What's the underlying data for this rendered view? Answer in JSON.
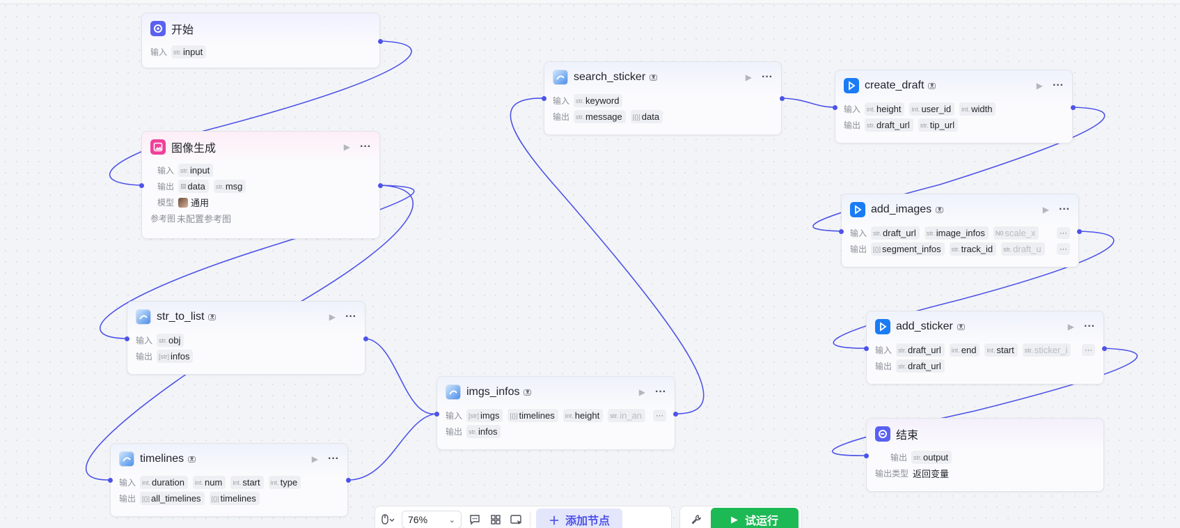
{
  "nodes": {
    "start": {
      "title": "开始",
      "input_label": "输入",
      "inputs": [
        {
          "type": "str.",
          "name": "input"
        }
      ]
    },
    "image_gen": {
      "title": "图像生成",
      "input_label": "输入",
      "inputs": [
        {
          "type": "str.",
          "name": "input"
        }
      ],
      "output_label": "输出",
      "outputs": [
        {
          "type": "img",
          "name": "data"
        },
        {
          "type": "str.",
          "name": "msg"
        }
      ],
      "model_label": "模型",
      "model_value": "通用",
      "ref_label": "参考图",
      "ref_value": "未配置参考图"
    },
    "search_sticker": {
      "title": "search_sticker",
      "input_label": "输入",
      "inputs": [
        {
          "type": "str.",
          "name": "keyword"
        }
      ],
      "output_label": "输出",
      "outputs": [
        {
          "type": "str.",
          "name": "message"
        },
        {
          "type": "[{}]",
          "name": "data"
        }
      ]
    },
    "create_draft": {
      "title": "create_draft",
      "input_label": "输入",
      "inputs": [
        {
          "type": "int.",
          "name": "height"
        },
        {
          "type": "int.",
          "name": "user_id"
        },
        {
          "type": "int.",
          "name": "width"
        }
      ],
      "output_label": "输出",
      "outputs": [
        {
          "type": "str.",
          "name": "draft_url"
        },
        {
          "type": "str.",
          "name": "tip_url"
        }
      ]
    },
    "add_images": {
      "title": "add_images",
      "input_label": "输入",
      "inputs": [
        {
          "type": "str.",
          "name": "draft_url"
        },
        {
          "type": "str.",
          "name": "image_infos"
        },
        {
          "type": "N0",
          "name": "scale_x"
        }
      ],
      "output_label": "输出",
      "outputs": [
        {
          "type": "[{}]",
          "name": "segment_infos"
        },
        {
          "type": "str.",
          "name": "track_id"
        },
        {
          "type": "str.",
          "name": "draft_u"
        }
      ],
      "more": "···"
    },
    "str_to_list": {
      "title": "str_to_list",
      "input_label": "输入",
      "inputs": [
        {
          "type": "str.",
          "name": "obj"
        }
      ],
      "output_label": "输出",
      "outputs": [
        {
          "type": "[str]",
          "name": "infos"
        }
      ]
    },
    "add_sticker": {
      "title": "add_sticker",
      "input_label": "输入",
      "inputs": [
        {
          "type": "str.",
          "name": "draft_url"
        },
        {
          "type": "int.",
          "name": "end"
        },
        {
          "type": "int.",
          "name": "start"
        },
        {
          "type": "str.",
          "name": "sticker_i"
        }
      ],
      "output_label": "输出",
      "outputs": [
        {
          "type": "str.",
          "name": "draft_url"
        }
      ],
      "more": "···"
    },
    "imgs_infos": {
      "title": "imgs_infos",
      "input_label": "输入",
      "inputs": [
        {
          "type": "[str]",
          "name": "imgs"
        },
        {
          "type": "[{}]",
          "name": "timelines"
        },
        {
          "type": "int.",
          "name": "height"
        },
        {
          "type": "str.",
          "name": "in_an"
        }
      ],
      "output_label": "输出",
      "outputs": [
        {
          "type": "str.",
          "name": "infos"
        }
      ],
      "more": "···"
    },
    "end": {
      "title": "结束",
      "output_label": "输出",
      "outputs": [
        {
          "type": "str.",
          "name": "output"
        }
      ],
      "output_type_label": "输出类型",
      "output_type_value": "返回变量"
    },
    "timelines": {
      "title": "timelines",
      "input_label": "输入",
      "inputs": [
        {
          "type": "int.",
          "name": "duration"
        },
        {
          "type": "int.",
          "name": "num"
        },
        {
          "type": "int.",
          "name": "start"
        },
        {
          "type": "int.",
          "name": "type"
        }
      ],
      "output_label": "输出",
      "outputs": [
        {
          "type": "[{}]",
          "name": "all_timelines"
        },
        {
          "type": "[{}]",
          "name": "timelines"
        }
      ]
    }
  },
  "node_icons": {
    "start": "start-icon",
    "image_gen": "image-icon",
    "plugin": "plugin-icon",
    "capcut": "capcut-icon",
    "end": "end-icon"
  },
  "toolbar": {
    "zoom": "76%",
    "add_node": "添加节点",
    "run": "试运行"
  },
  "colors": {
    "wire": "#4d53e8",
    "run_button": "#1db954",
    "add_node_bg": "#e4e6fb"
  }
}
